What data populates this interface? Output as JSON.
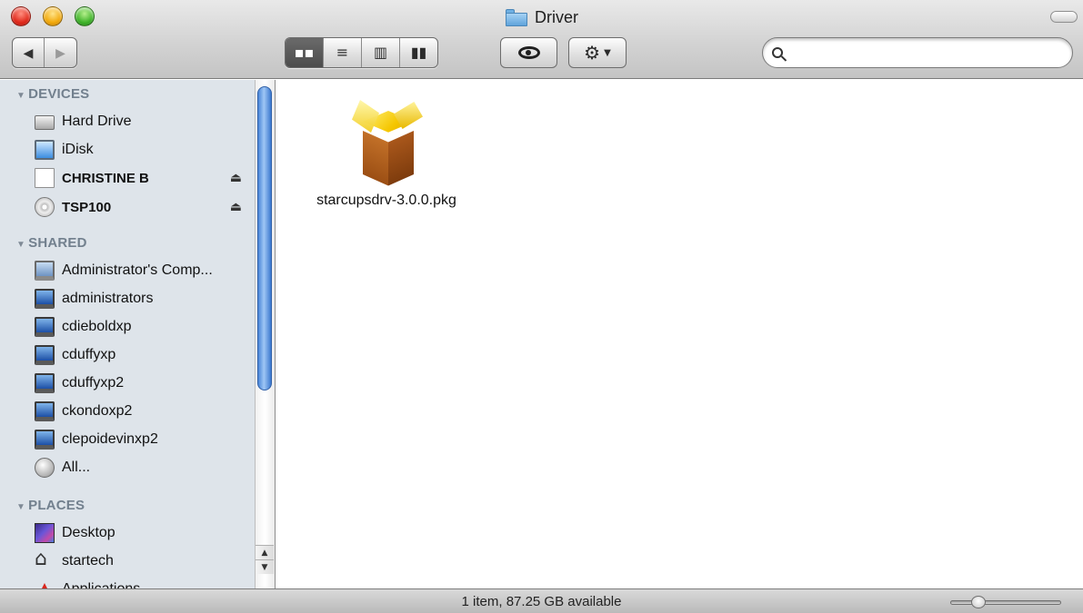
{
  "window": {
    "title": "Driver"
  },
  "toolbar": {
    "nav": {
      "back_icon": "back-arrow-icon",
      "forward_icon": "forward-arrow-icon"
    },
    "view_modes": [
      {
        "name": "icon-view",
        "icon": "icon-view-icon",
        "selected": true
      },
      {
        "name": "list-view",
        "icon": "list-view-icon",
        "selected": false
      },
      {
        "name": "column-view",
        "icon": "column-view-icon",
        "selected": false
      },
      {
        "name": "coverflow-view",
        "icon": "coverflow-view-icon",
        "selected": false
      }
    ],
    "quick_look_icon": "eye-icon",
    "action_icon": "gear-icon",
    "search": {
      "value": "",
      "placeholder": ""
    }
  },
  "sidebar": {
    "devices": {
      "header": "DEVICES",
      "items": [
        {
          "label": "Hard Drive",
          "icon": "hard-drive-icon"
        },
        {
          "label": "iDisk",
          "icon": "idisk-icon"
        },
        {
          "label": "CHRISTINE B",
          "icon": "usb-drive-icon",
          "ejectable": true
        },
        {
          "label": "TSP100",
          "icon": "cd-icon",
          "ejectable": true
        }
      ]
    },
    "shared": {
      "header": "SHARED",
      "items": [
        {
          "label": "Administrator's Comp...",
          "icon": "computer-icon"
        },
        {
          "label": "administrators",
          "icon": "pc-icon"
        },
        {
          "label": "cdieboldxp",
          "icon": "pc-icon"
        },
        {
          "label": "cduffyxp",
          "icon": "pc-icon"
        },
        {
          "label": "cduffyxp2",
          "icon": "pc-icon"
        },
        {
          "label": "ckondoxp2",
          "icon": "pc-icon"
        },
        {
          "label": "clepoidevinxp2",
          "icon": "pc-icon"
        },
        {
          "label": "All...",
          "icon": "network-globe-icon"
        }
      ]
    },
    "places": {
      "header": "PLACES",
      "items": [
        {
          "label": "Desktop",
          "icon": "desktop-icon"
        },
        {
          "label": "startech",
          "icon": "home-icon"
        },
        {
          "label": "Applications",
          "icon": "applications-icon"
        }
      ]
    }
  },
  "content": {
    "files": [
      {
        "name": "starcupsdrv-3.0.0.pkg",
        "icon": "package-icon"
      }
    ]
  },
  "status": {
    "text": "1 item, 87.25 GB available",
    "icon_size_level": 0.2
  },
  "colors": {
    "sidebar_bg": "#dee4ea",
    "section_header": "#72808e",
    "scroll_thumb": "#4a86d8"
  }
}
